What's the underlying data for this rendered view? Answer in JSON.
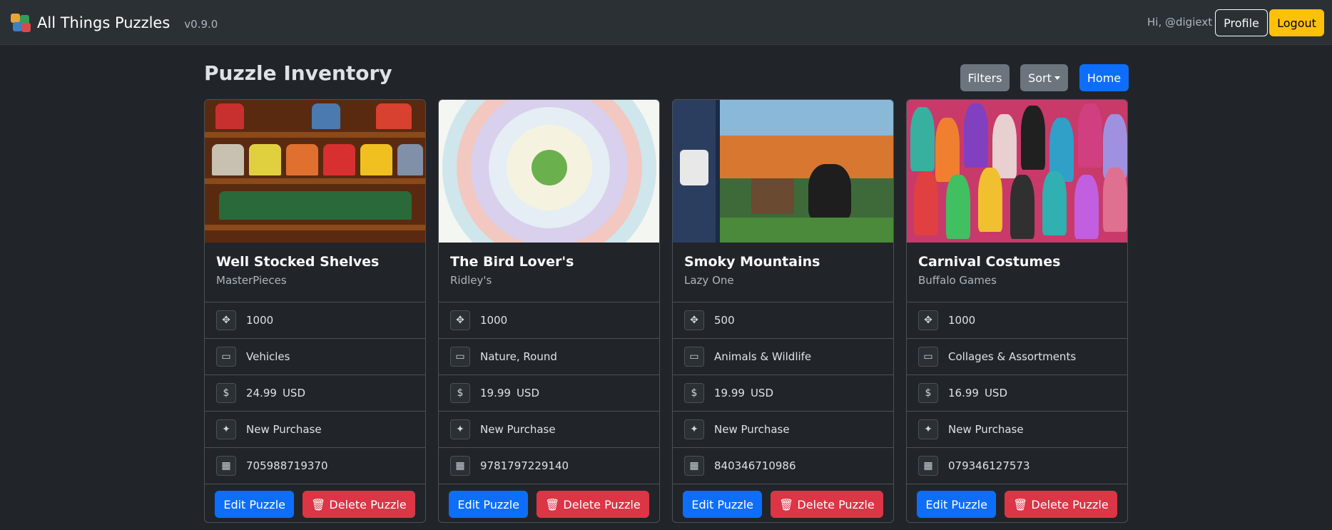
{
  "app": {
    "title": "All Things Puzzles",
    "version": "v0.9.0"
  },
  "user": {
    "greeting": "Hi, @digiext",
    "profile_label": "Profile",
    "logout_label": "Logout"
  },
  "page": {
    "title": "Puzzle Inventory"
  },
  "toolbar": {
    "filters_label": "Filters",
    "sort_label": "Sort",
    "home_label": "Home"
  },
  "icons": {
    "pieces": "puzzle-piece-icon",
    "category": "folder-icon",
    "price": "dollar-icon",
    "status": "sparkles-icon",
    "barcode": "qr-code-icon",
    "delete": "trash-icon"
  },
  "colors": {
    "primary": "#0d6efd",
    "danger": "#dc3545",
    "warning": "#ffc107",
    "secondary": "#6c757d"
  },
  "puzzles": [
    {
      "title": "Well Stocked Shelves",
      "maker": "MasterPieces",
      "pieces": "1000",
      "category": "Vehicles",
      "price": "24.99",
      "currency": "USD",
      "status": "New Purchase",
      "upc": "705988719370",
      "edit_label": "Edit Puzzle",
      "delete_label": "Delete Puzzle"
    },
    {
      "title": "The Bird Lover's",
      "maker": "Ridley's",
      "pieces": "1000",
      "category": "Nature, Round",
      "price": "19.99",
      "currency": "USD",
      "status": "New Purchase",
      "upc": "9781797229140",
      "edit_label": "Edit Puzzle",
      "delete_label": "Delete Puzzle"
    },
    {
      "title": "Smoky Mountains",
      "maker": "Lazy One",
      "pieces": "500",
      "category": "Animals & Wildlife",
      "price": "19.99",
      "currency": "USD",
      "status": "New Purchase",
      "upc": "840346710986",
      "edit_label": "Edit Puzzle",
      "delete_label": "Delete Puzzle"
    },
    {
      "title": "Carnival Costumes",
      "maker": "Buffalo Games",
      "pieces": "1000",
      "category": "Collages & Assortments",
      "price": "16.99",
      "currency": "USD",
      "status": "New Purchase",
      "upc": "079346127573",
      "edit_label": "Edit Puzzle",
      "delete_label": "Delete Puzzle"
    }
  ]
}
